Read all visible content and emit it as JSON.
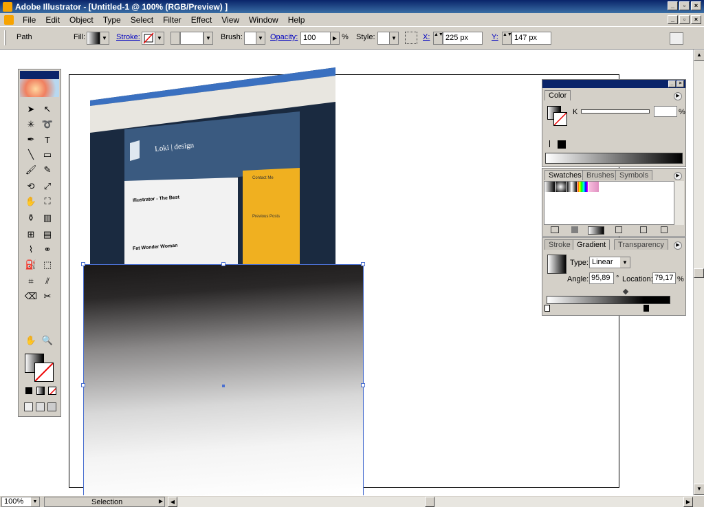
{
  "window": {
    "title": "Adobe Illustrator - [Untitled-1 @ 100% (RGB/Preview) ]"
  },
  "menu": [
    "File",
    "Edit",
    "Object",
    "Type",
    "Select",
    "Filter",
    "Effect",
    "View",
    "Window",
    "Help"
  ],
  "control": {
    "object_type": "Path",
    "fill_label": "Fill:",
    "stroke_label": "Stroke:",
    "brush_label": "Brush:",
    "opacity_label": "Opacity:",
    "opacity_value": "100",
    "percent": "%",
    "style_label": "Style:",
    "x_label": "X:",
    "x_value": "225 px",
    "y_label": "Y:",
    "y_value": "147 px"
  },
  "color_panel": {
    "tab": "Color",
    "channel": "K",
    "percent": "%"
  },
  "swatches_panel": {
    "tabs": [
      "Swatches",
      "Brushes",
      "Symbols"
    ]
  },
  "gradient_panel": {
    "tabs": [
      "Stroke",
      "Gradient",
      "Transparency"
    ],
    "type_label": "Type:",
    "type_value": "Linear",
    "angle_label": "Angle:",
    "angle_value": "95,89",
    "degree": "°",
    "location_label": "Location:",
    "location_value": "79,17",
    "percent": "%"
  },
  "website_preview": {
    "logo_text": "Loki | design",
    "post1": "Illustrator - The Best",
    "post2": "Fat Wonder Woman",
    "side1": "Contact Me",
    "side2": "Previous Posts"
  },
  "status": {
    "zoom": "100%",
    "mode": "Selection"
  }
}
